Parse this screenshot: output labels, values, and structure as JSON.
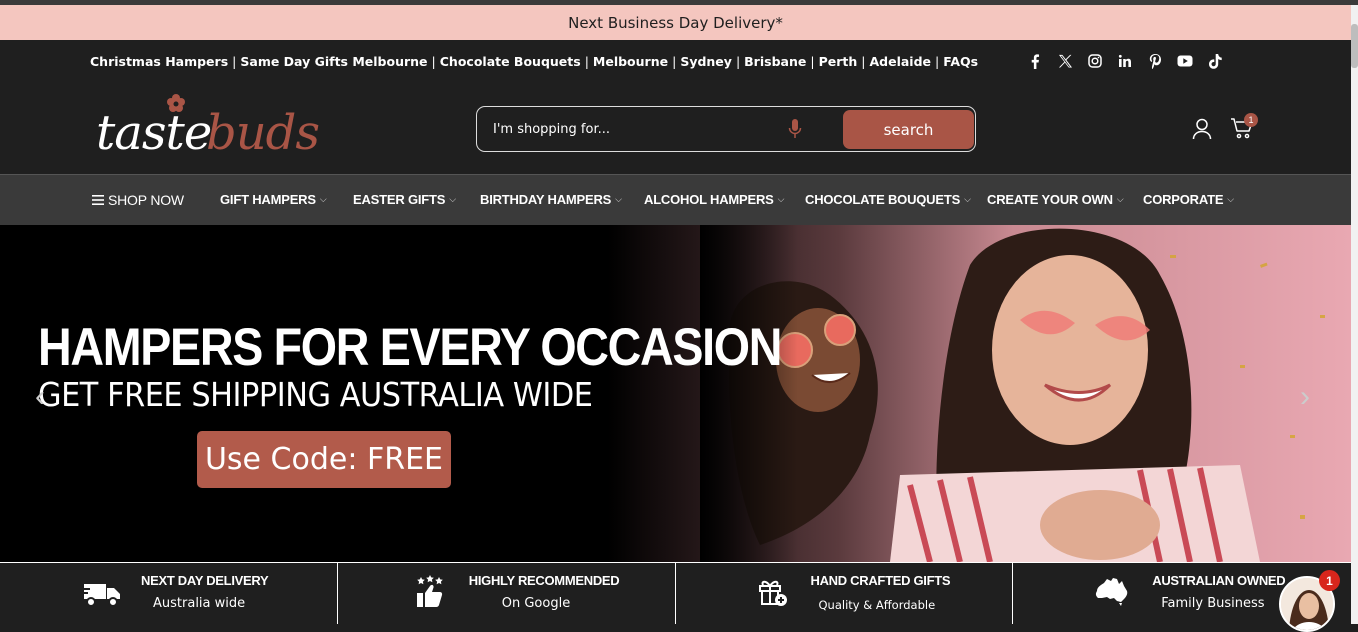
{
  "announcement": "Next Business Day Delivery*",
  "quick_links": [
    "Christmas Hampers",
    "Same Day Gifts Melbourne",
    "Chocolate Bouquets",
    "Melbourne",
    "Sydney",
    "Brisbane",
    "Perth",
    "Adelaide",
    "FAQs"
  ],
  "social": [
    "facebook-icon",
    "x-icon",
    "instagram-icon",
    "linkedin-icon",
    "pinterest-icon",
    "youtube-icon",
    "tiktok-icon"
  ],
  "logo": "tastebuds",
  "search": {
    "placeholder": "I'm shopping for...",
    "button": "search"
  },
  "cart": {
    "count": "1"
  },
  "nav": [
    {
      "label": "SHOP NOW"
    },
    {
      "label": "GIFT HAMPERS"
    },
    {
      "label": "EASTER GIFTS"
    },
    {
      "label": "BIRTHDAY HAMPERS"
    },
    {
      "label": "ALCOHOL HAMPERS"
    },
    {
      "label": "CHOCOLATE BOUQUETS"
    },
    {
      "label": "CREATE YOUR OWN"
    },
    {
      "label": "CORPORATE"
    }
  ],
  "hero": {
    "title": "HAMPERS FOR EVERY OCCASION",
    "subtitle": "GET FREE SHIPPING AUSTRALIA WIDE",
    "cta": "Use Code: FREE"
  },
  "features": [
    {
      "title": "NEXT DAY DELIVERY",
      "subtitle": "Australia wide",
      "icon": "truck-icon"
    },
    {
      "title": "HIGHLY RECOMMENDED",
      "subtitle": "On Google",
      "icon": "thumbs-up-icon"
    },
    {
      "title": "HAND CRAFTED GIFTS",
      "subtitle": "Quality & Affordable",
      "icon": "gift-icon"
    },
    {
      "title": "AUSTRALIAN OWNED",
      "subtitle": "Family Business",
      "icon": "australia-icon"
    }
  ],
  "chat": {
    "badge": "1"
  },
  "colors": {
    "accent": "#a95546",
    "announcement_bg": "#f4c6bf",
    "header_bg": "#1f1f1f",
    "nav_bg": "#3a3a3a"
  }
}
